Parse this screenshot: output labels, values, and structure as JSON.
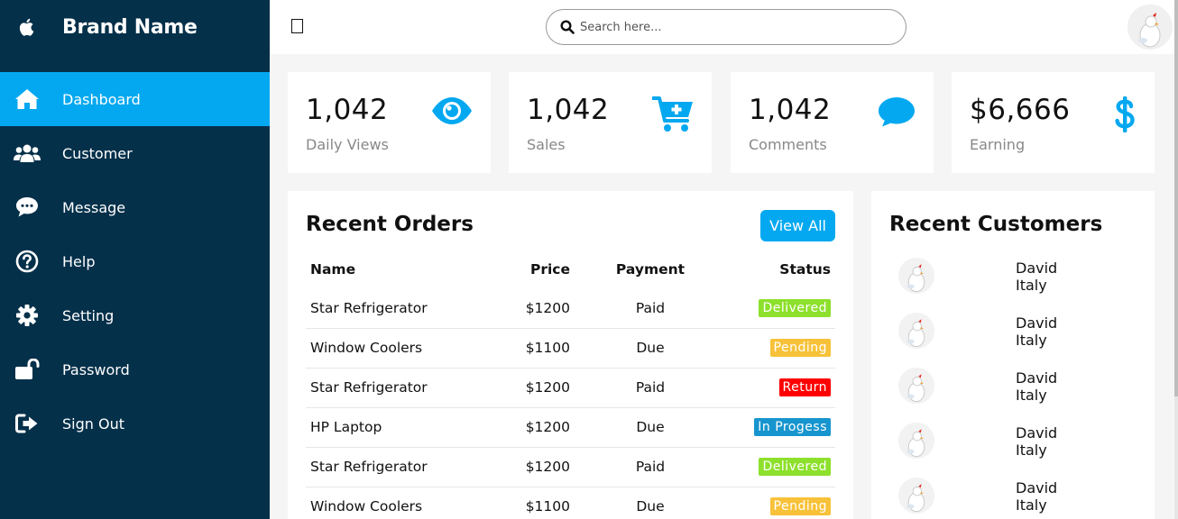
{
  "brand": {
    "name": "Brand Name",
    "icon": "apple-icon"
  },
  "nav": [
    {
      "label": "Dashboard",
      "icon": "home-icon",
      "active": true
    },
    {
      "label": "Customer",
      "icon": "users-icon"
    },
    {
      "label": "Message",
      "icon": "chat-icon"
    },
    {
      "label": "Help",
      "icon": "help-icon"
    },
    {
      "label": "Setting",
      "icon": "gear-icon"
    },
    {
      "label": "Password",
      "icon": "lock-icon"
    },
    {
      "label": "Sign Out",
      "icon": "sign-out-icon"
    }
  ],
  "search": {
    "placeholder": "Search here..."
  },
  "cards": [
    {
      "value": "1,042",
      "label": "Daily Views",
      "icon": "eye-icon"
    },
    {
      "value": "1,042",
      "label": "Sales",
      "icon": "cart-icon"
    },
    {
      "value": "1,042",
      "label": "Comments",
      "icon": "comment-icon"
    },
    {
      "value": "$6,666",
      "label": "Earning",
      "icon": "dollar-icon"
    }
  ],
  "orders": {
    "title": "Recent Orders",
    "view_all": "View All",
    "headers": {
      "name": "Name",
      "price": "Price",
      "payment": "Payment",
      "status": "Status"
    },
    "rows": [
      {
        "name": "Star Refrigerator",
        "price": "$1200",
        "payment": "Paid",
        "status": "Delivered"
      },
      {
        "name": "Window Coolers",
        "price": "$1100",
        "payment": "Due",
        "status": "Pending"
      },
      {
        "name": "Star Refrigerator",
        "price": "$1200",
        "payment": "Paid",
        "status": "Return"
      },
      {
        "name": "HP Laptop",
        "price": "$1200",
        "payment": "Due",
        "status": "In Progess"
      },
      {
        "name": "Star Refrigerator",
        "price": "$1200",
        "payment": "Paid",
        "status": "Delivered"
      },
      {
        "name": "Window Coolers",
        "price": "$1100",
        "payment": "Due",
        "status": "Pending"
      }
    ]
  },
  "customers": {
    "title": "Recent Customers",
    "items": [
      {
        "name": "David",
        "country": "Italy"
      },
      {
        "name": "David",
        "country": "Italy"
      },
      {
        "name": "David",
        "country": "Italy"
      },
      {
        "name": "David",
        "country": "Italy"
      },
      {
        "name": "David",
        "country": "Italy"
      }
    ]
  },
  "colors": {
    "sidebar": "#05304a",
    "accent": "#04a8f0",
    "status": {
      "Delivered": "#8de02c",
      "Pending": "#f7c23a",
      "Return": "#f00",
      "In Progess": "#1795ce"
    }
  }
}
